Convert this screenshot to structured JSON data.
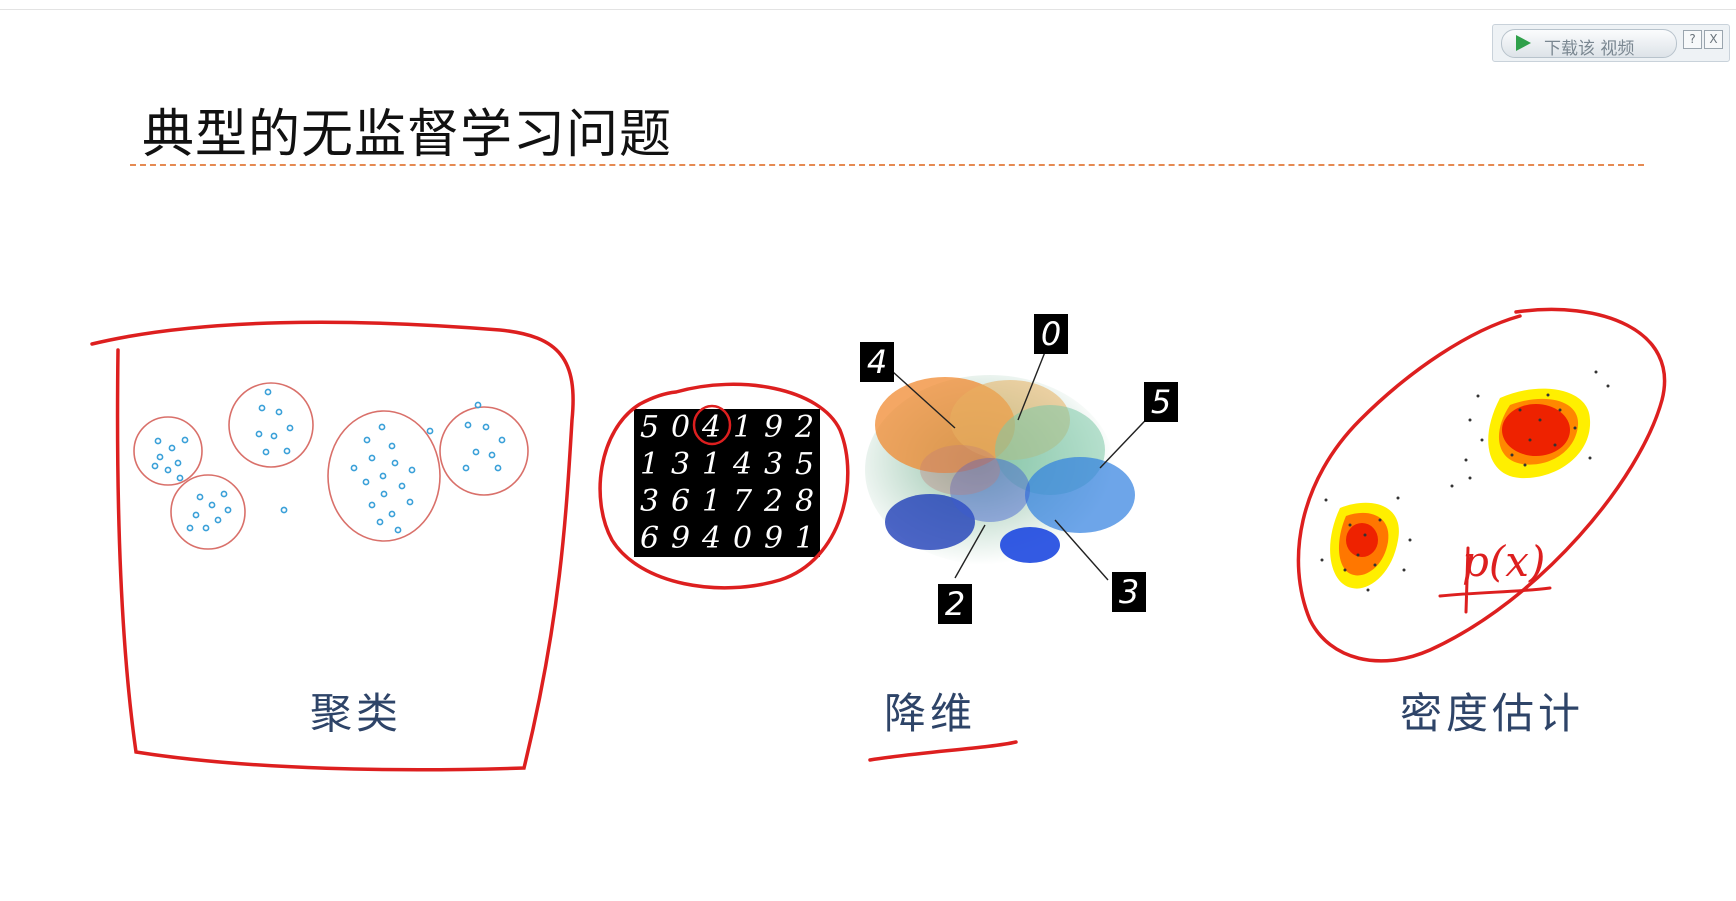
{
  "slide": {
    "title": "典型的无监督学习问题"
  },
  "download_bar": {
    "label": "下载该 视频",
    "help": "?",
    "close": "X"
  },
  "sections": {
    "clustering": {
      "caption": "聚类"
    },
    "dim_reduction": {
      "caption": "降维",
      "mnist_rows": [
        [
          "5",
          "0",
          "4",
          "1",
          "9",
          "2"
        ],
        [
          "1",
          "3",
          "1",
          "4",
          "3",
          "5"
        ],
        [
          "3",
          "6",
          "1",
          "7",
          "2",
          "8"
        ],
        [
          "6",
          "9",
          "4",
          "0",
          "9",
          "1"
        ]
      ],
      "embedding_labels": [
        "4",
        "0",
        "5",
        "2",
        "3"
      ]
    },
    "density_estimation": {
      "caption": "密度估计",
      "annotation": "p(x)"
    }
  },
  "colors": {
    "ink_red": "#dd1f1f",
    "cluster_circle": "#d9706a",
    "cluster_point": "#3aa0d8",
    "caption_blue": "#2e4468",
    "title_rule": "#e58a52"
  }
}
